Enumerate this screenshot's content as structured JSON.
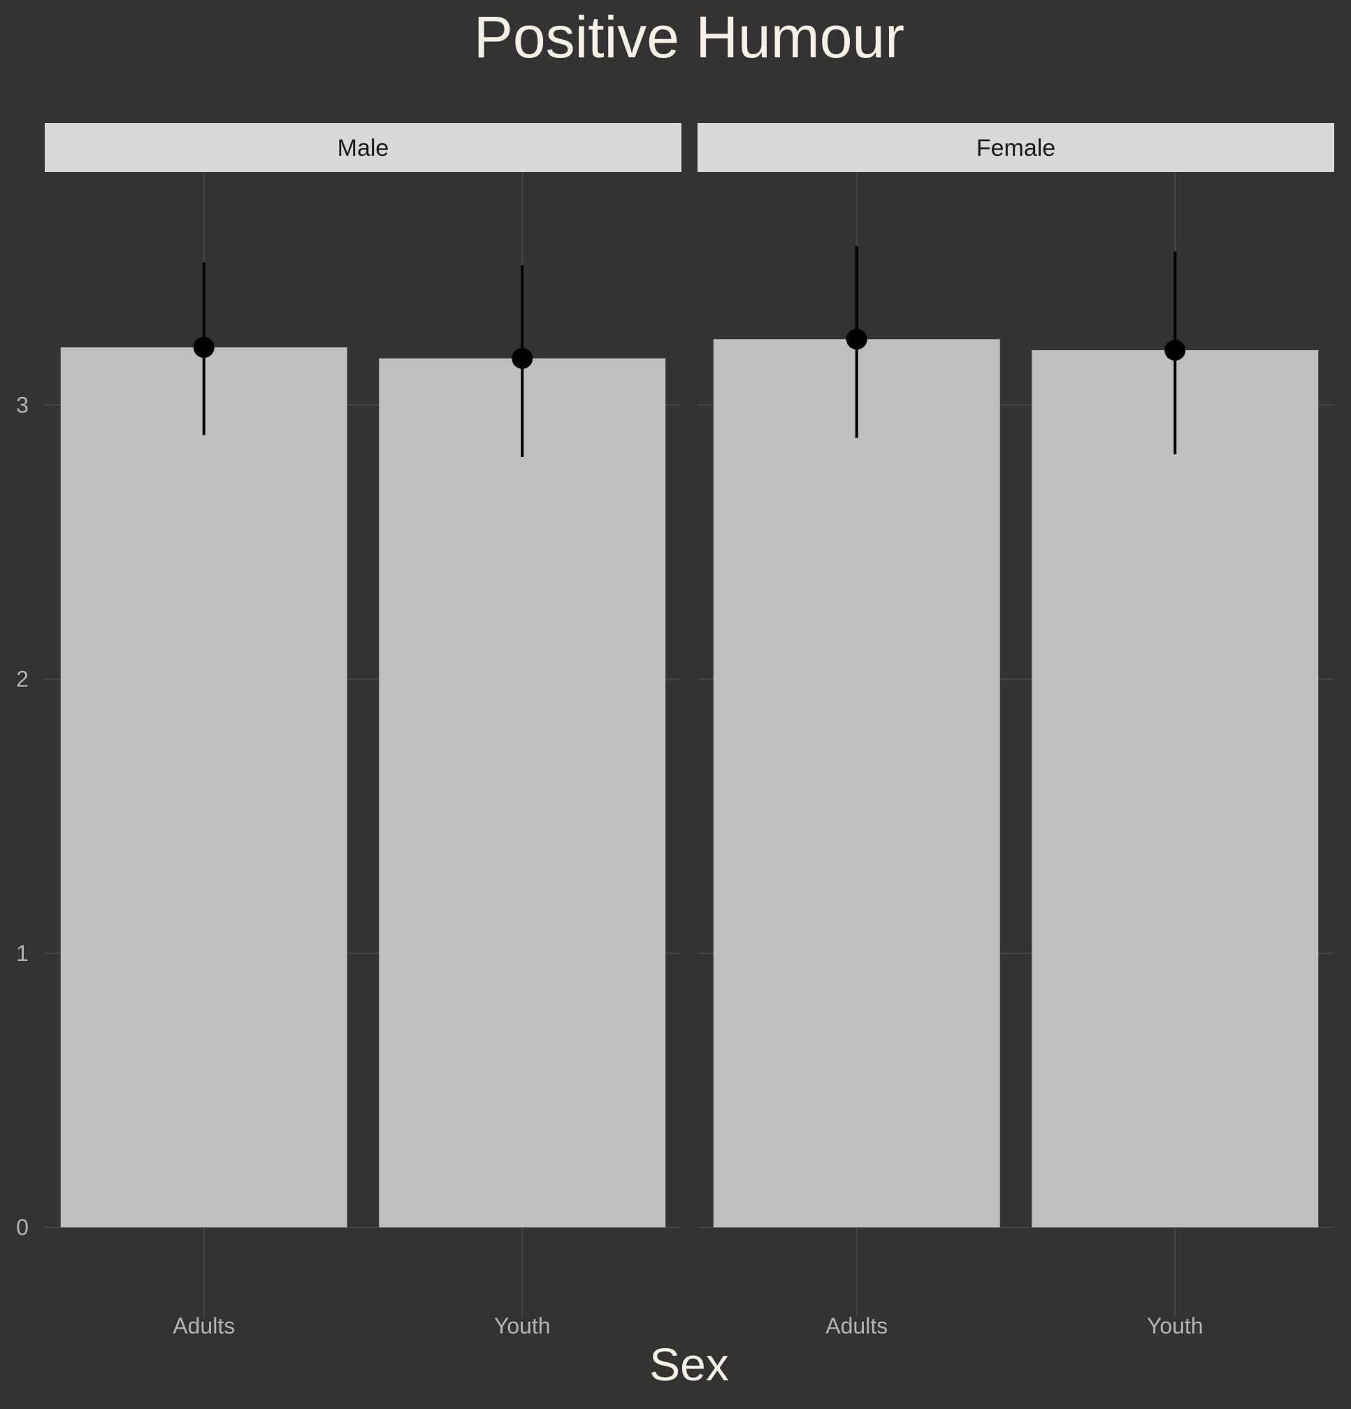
{
  "chart_data": {
    "type": "bar",
    "title": "Positive Humour",
    "xlabel": "Sex",
    "ylabel": "",
    "ylim": [
      -0.15,
      3.85
    ],
    "yticks": [
      0,
      1,
      2,
      3
    ],
    "grid": true,
    "error_bars": true,
    "categories": [
      "Adults",
      "Youth"
    ],
    "facets": [
      {
        "name": "Male",
        "values": [
          3.21,
          3.17
        ],
        "lower": [
          2.89,
          2.81
        ],
        "upper": [
          3.52,
          3.51
        ]
      },
      {
        "name": "Female",
        "values": [
          3.24,
          3.2
        ],
        "lower": [
          2.88,
          2.82
        ],
        "upper": [
          3.58,
          3.56
        ]
      }
    ],
    "colors": {
      "background": "#333333",
      "bar": "#bfbfbf",
      "strip": "#d9d9d9",
      "grid": "#4d4d4d",
      "point": "#000000",
      "title": "#f5f1e6",
      "tick": "#b3b3b3"
    }
  }
}
